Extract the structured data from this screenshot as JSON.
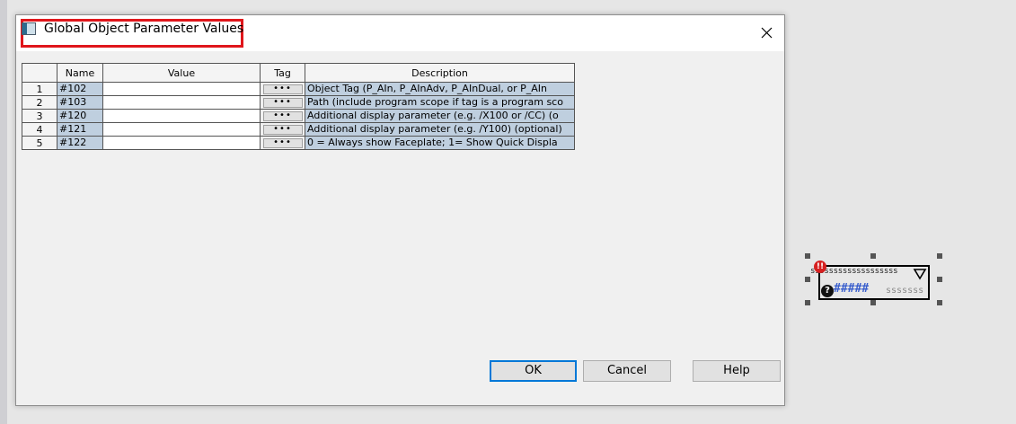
{
  "dialog": {
    "title": "Global Object Parameter Values",
    "close_icon": "close-icon"
  },
  "table": {
    "columns": [
      "Name",
      "Value",
      "Tag",
      "Description"
    ],
    "rows": [
      {
        "num": "1",
        "name": "#102",
        "value": "",
        "tag": "•••",
        "description": "Object Tag (P_AIn, P_AInAdv, P_AInDual, or P_AIn"
      },
      {
        "num": "2",
        "name": "#103",
        "value": "",
        "tag": "•••",
        "description": "Path (include program scope if tag is a program sco"
      },
      {
        "num": "3",
        "name": "#120",
        "value": "",
        "tag": "•••",
        "description": "Additional display parameter (e.g. /X100 or /CC) (o"
      },
      {
        "num": "4",
        "name": "#121",
        "value": "",
        "tag": "•••",
        "description": "Additional display parameter (e.g. /Y100) (optional)"
      },
      {
        "num": "5",
        "name": "#122",
        "value": "",
        "tag": "•••",
        "description": "0 = Always show Faceplate;  1= Show Quick Displa"
      }
    ]
  },
  "buttons": {
    "ok": "OK",
    "cancel": "Cancel",
    "help": "Help"
  },
  "graphic_object": {
    "label": "sssssssssssssssssss",
    "value": "#####",
    "units": "sssssss",
    "alarm_symbol": "!!",
    "help_symbol": "?"
  },
  "colors": {
    "highlight_border": "#e0161b",
    "selected_cell": "#bfcfdf",
    "default_button_border": "#0078d7",
    "value_text": "#3a5fcd"
  }
}
